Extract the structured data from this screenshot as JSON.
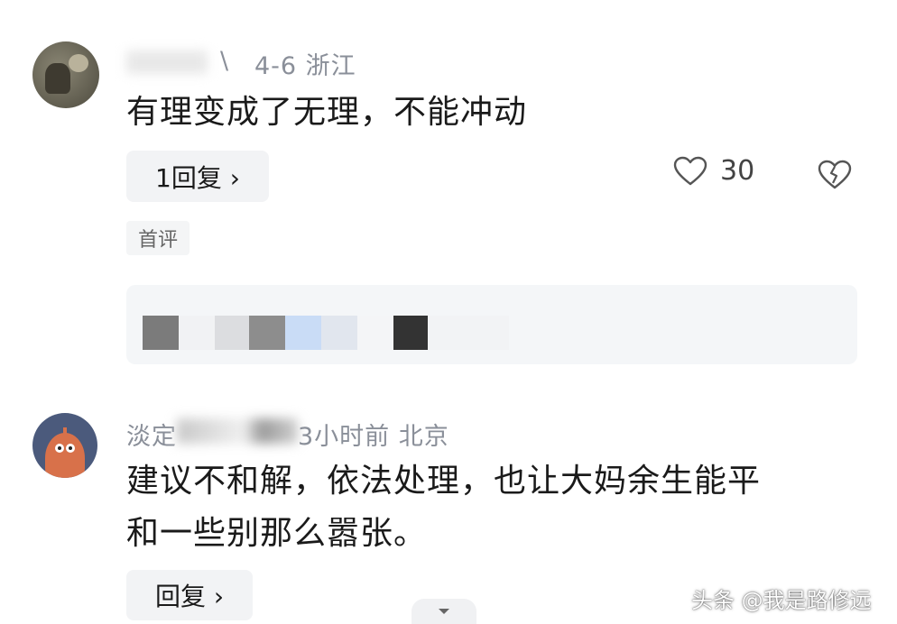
{
  "comments": [
    {
      "meta": "4-6  浙江",
      "text": "有理变成了无理，不能冲动",
      "reply_label": "1回复 ›",
      "like_count": "30",
      "tag": "首评"
    },
    {
      "username": "淡定",
      "meta": "3小时前  北京",
      "text_line1": "建议不和解，依法处理，也让大妈余生能平",
      "text_line2": "和一些别那么嚣张。",
      "reply_label": "回复 ›"
    }
  ],
  "watermark": "头条 @我是路修远",
  "colors": {
    "meta": "#8a8f99",
    "panel": "#f4f6f8",
    "button": "#f2f3f5"
  },
  "icons": [
    "heart-icon",
    "broken-heart-icon",
    "chevron-down-icon"
  ]
}
